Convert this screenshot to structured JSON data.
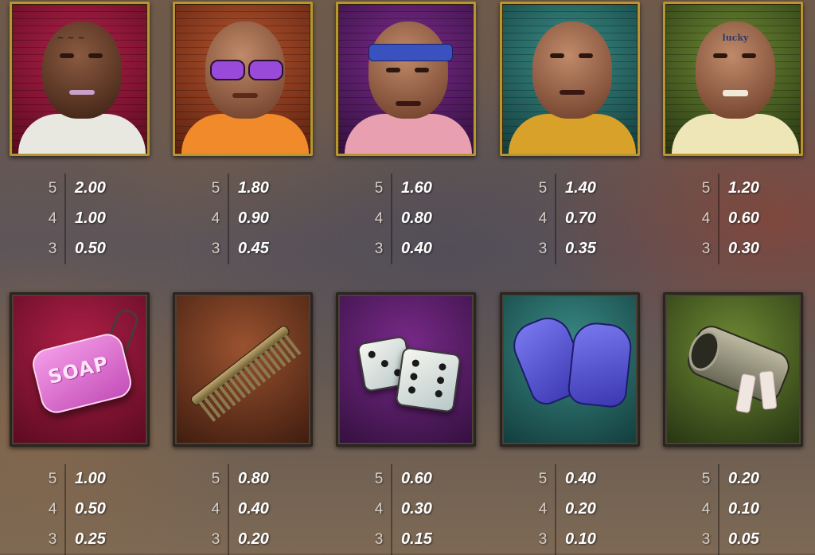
{
  "pay_counts": [
    "5",
    "4",
    "3"
  ],
  "symbols_top": [
    {
      "name": "bald tattooed inmate",
      "bg": "red",
      "tattoo": "",
      "values": [
        "2.00",
        "1.00",
        "0.50"
      ]
    },
    {
      "name": "inmate with purple sunglasses",
      "bg": "orange",
      "tattoo": "",
      "values": [
        "1.80",
        "0.90",
        "0.45"
      ]
    },
    {
      "name": "inmate with blue bandana",
      "bg": "purple",
      "tattoo": "",
      "values": [
        "1.60",
        "0.80",
        "0.40"
      ]
    },
    {
      "name": "bald inmate yellow shirt",
      "bg": "teal",
      "tattoo": "",
      "values": [
        "1.40",
        "0.70",
        "0.35"
      ]
    },
    {
      "name": "lucky tattooed inmate",
      "bg": "green",
      "tattoo": "lucky",
      "values": [
        "1.20",
        "0.60",
        "0.30"
      ]
    }
  ],
  "symbols_bottom": [
    {
      "name": "soap",
      "bg": "red",
      "label": "SOAP",
      "values": [
        "1.00",
        "0.50",
        "0.25"
      ]
    },
    {
      "name": "comb",
      "bg": "brown",
      "label": "",
      "values": [
        "0.80",
        "0.40",
        "0.20"
      ]
    },
    {
      "name": "dice",
      "bg": "purple",
      "label": "",
      "values": [
        "0.60",
        "0.30",
        "0.15"
      ]
    },
    {
      "name": "gloves",
      "bg": "teal",
      "label": "",
      "values": [
        "0.40",
        "0.20",
        "0.10"
      ]
    },
    {
      "name": "toilet paper",
      "bg": "green",
      "label": "",
      "values": [
        "0.20",
        "0.10",
        "0.05"
      ]
    }
  ],
  "colors": {
    "gold_frame": "#b89530",
    "text": "#ffffff",
    "count_text": "#d8d0c8"
  }
}
